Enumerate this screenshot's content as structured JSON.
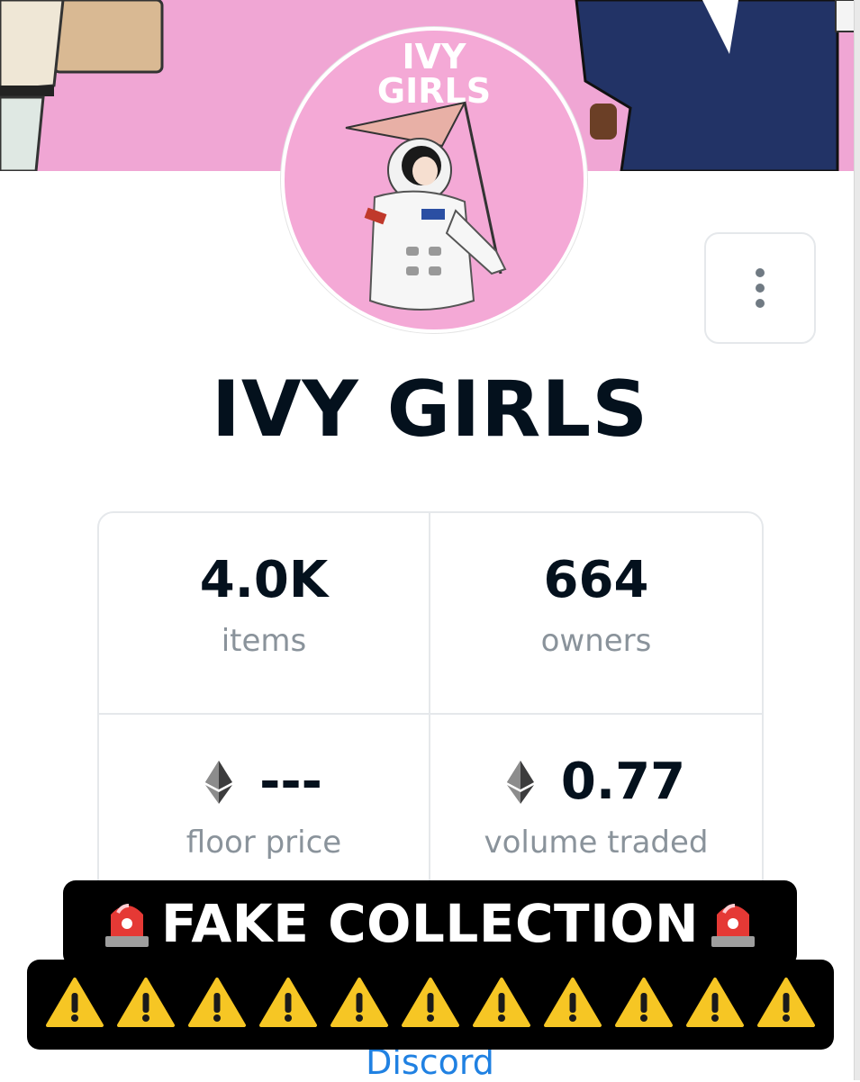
{
  "collection": {
    "avatar_text_line1": "IVY",
    "avatar_text_line2": "GIRLS",
    "name": "IVY GIRLS"
  },
  "stats": [
    {
      "value": "4.0K",
      "label": "items",
      "icon": ""
    },
    {
      "value": "664",
      "label": "owners",
      "icon": ""
    },
    {
      "value": "---",
      "label": "floor price",
      "icon": "ethereum-icon"
    },
    {
      "value": "0.77",
      "label": "volume traded",
      "icon": "ethereum-icon"
    }
  ],
  "overlay": {
    "headline": "FAKE COLLECTION",
    "headline_icon": "police-light-icon",
    "warning_icon": "warning-icon",
    "warning_count": 11
  },
  "links": {
    "discord": "Discord"
  },
  "colors": {
    "banner_bg": "#f0a6d4",
    "title_text": "#04111d",
    "label_text": "#8a939b",
    "link": "#2081e2",
    "overlay_bg": "#000000"
  }
}
